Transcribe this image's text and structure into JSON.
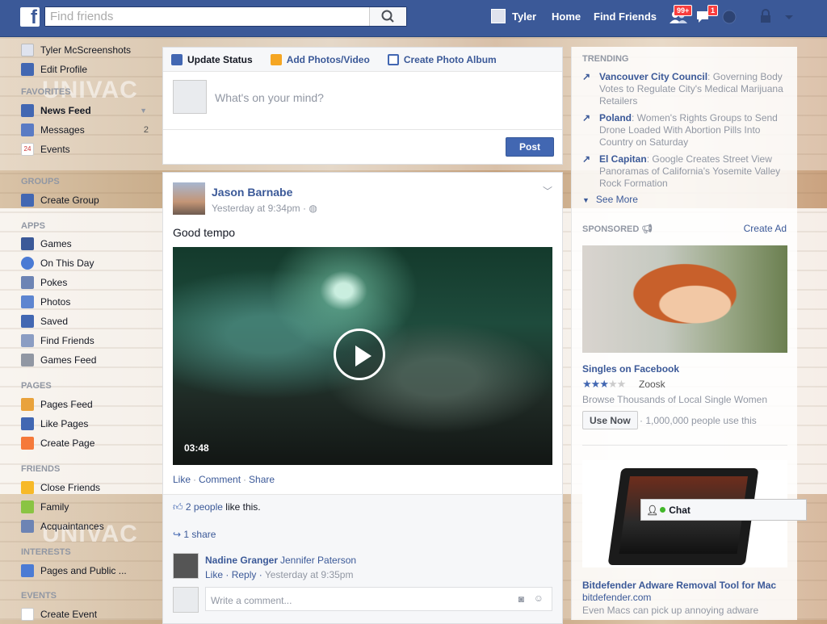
{
  "topbar": {
    "logo": "f",
    "search_placeholder": "Find friends",
    "user_name": "Tyler",
    "home": "Home",
    "find_friends": "Find Friends",
    "friend_requests_badge": "99+",
    "messages_badge": "1",
    "accent": "#3b5998"
  },
  "left": {
    "profile_name": "Tyler McScreenshots",
    "edit_profile": "Edit Profile",
    "favorites_head": "FAVORITES",
    "news_feed": "News Feed",
    "messages": "Messages",
    "messages_count": "2",
    "events": "Events",
    "events_icon_num": "24",
    "groups_head": "GROUPS",
    "create_group": "Create Group",
    "apps_head": "APPS",
    "games": "Games",
    "on_this_day": "On This Day",
    "pokes": "Pokes",
    "photos": "Photos",
    "saved": "Saved",
    "find_friends": "Find Friends",
    "games_feed": "Games Feed",
    "pages_head": "PAGES",
    "pages_feed": "Pages Feed",
    "like_pages": "Like Pages",
    "create_page": "Create Page",
    "friends_head": "FRIENDS",
    "close_friends": "Close Friends",
    "family": "Family",
    "acquaintances": "Acquaintances",
    "interests_head": "INTERESTS",
    "pages_public": "Pages and Public ...",
    "events_head": "EVENTS",
    "create_event": "Create Event"
  },
  "composer": {
    "tab_update": "Update Status",
    "tab_photos": "Add Photos/Video",
    "tab_album": "Create Photo Album",
    "placeholder": "What's on your mind?",
    "post_button": "Post"
  },
  "post": {
    "author": "Jason Barnabe",
    "time": "Yesterday at 9:34pm ·",
    "text": "Good tempo",
    "duration": "03:48",
    "like": "Like",
    "comment": "Comment",
    "share": "Share",
    "likes_count": "2 people",
    "likes_suffix": " like this.",
    "shares": "1 share",
    "commenter": "Nadine Granger",
    "comment_text": "Jennifer Paterson",
    "comment_like": "Like",
    "comment_reply": "Reply",
    "comment_time": "Yesterday at 9:35pm",
    "write_placeholder": "Write a comment..."
  },
  "right": {
    "trending_head": "TRENDING",
    "trends": [
      {
        "topic": "Vancouver City Council",
        "desc": ": Governing Body Votes to Regulate City's Medical Marijuana Retailers"
      },
      {
        "topic": "Poland",
        "desc": ": Women's Rights Groups to Send Drone Loaded With Abortion Pills Into Country on Saturday"
      },
      {
        "topic": "El Capitan",
        "desc": ": Google Creates Street View Panoramas of California's Yosemite Valley Rock Formation"
      }
    ],
    "see_more": "See More",
    "sponsored_head": "SPONSORED",
    "create_ad": "Create Ad",
    "ad1_title": "Singles on Facebook",
    "ad1_rating": 2.5,
    "ad1_brand": "Zoosk",
    "ad1_desc": "Browse Thousands of Local Single Women",
    "ad1_button": "Use Now",
    "ad1_meta": "· 1,000,000 people use this",
    "ad2_title": "Bitdefender Adware Removal Tool for Mac",
    "ad2_domain": "bitdefender.com",
    "ad2_desc": "Even Macs can pick up annoying adware"
  },
  "chat": {
    "label": "Chat"
  }
}
